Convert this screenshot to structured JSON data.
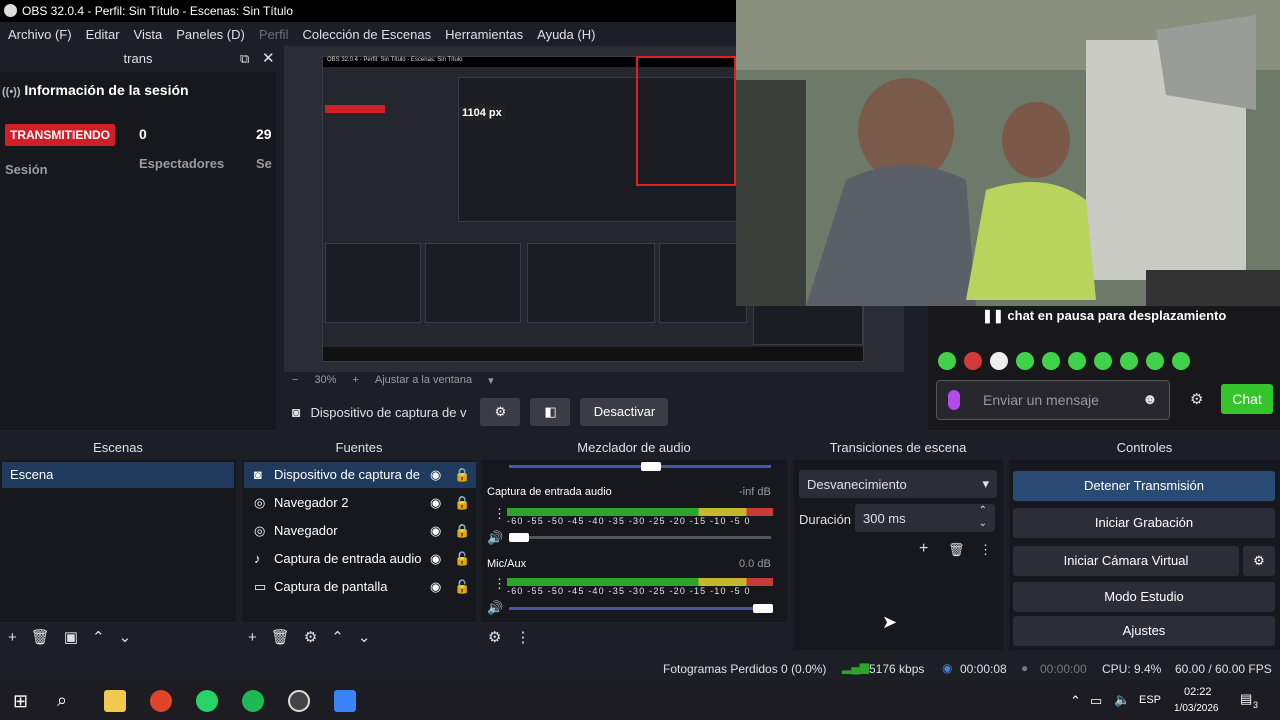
{
  "window": {
    "title": "OBS 32.0.4 - Perfil: Sin Título - Escenas: Sin Título"
  },
  "menu": {
    "items": [
      "Archivo (F)",
      "Editar",
      "Vista",
      "Paneles (D)",
      "Perfil",
      "Colección de Escenas",
      "Herramientas",
      "Ayuda (H)"
    ]
  },
  "dock": {
    "title": "trans",
    "session_heading": "Información de la sesión",
    "live_badge": "TRANSMITIENDO",
    "viewers_value": "0",
    "extra_value": "29",
    "session_label": "Sesión",
    "viewers_label": "Espectadores",
    "extra_label": "Se"
  },
  "preview": {
    "mini_title": "OBS 32.0.4 - Perfil: Sin Título - Escenas: Sin Título",
    "overlay_px": "1104 px",
    "zoom": "30%",
    "fit_label": "Ajustar a la ventana"
  },
  "source_toolbar": {
    "source_name": "Dispositivo de captura de v",
    "deactivate": "Desactivar"
  },
  "chat": {
    "paused": "chat en pausa para desplazamiento",
    "placeholder": "Enviar un mensaje",
    "button": "Chat"
  },
  "docks": {
    "scenes": "Escenas",
    "sources": "Fuentes",
    "mixer": "Mezclador de audio",
    "transitions": "Transiciones de escena",
    "controls": "Controles"
  },
  "scenes": [
    "Escena"
  ],
  "sources": [
    "Dispositivo de captura de v",
    "Navegador 2",
    "Navegador",
    "Captura de entrada audio",
    "Captura de pantalla"
  ],
  "mixer": {
    "ch1_name": "Captura de entrada audio",
    "ch1_db": "-inf dB",
    "ch2_name": "Mic/Aux",
    "ch2_db": "0.0 dB",
    "scale": "-60 -55 -50 -45 -40 -35 -30 -25 -20 -15 -10 -5 0"
  },
  "transitions": {
    "type": "Desvanecimiento",
    "duration_label": "Duración",
    "duration_value": "300 ms"
  },
  "controls": [
    "Detener Transmisión",
    "Iniciar Grabación",
    "Iniciar Cámara Virtual",
    "Modo Estudio",
    "Ajustes"
  ],
  "status": {
    "dropped": "Fotogramas Perdidos 0 (0.0%)",
    "bitrate": "5176 kbps",
    "stream_time": "00:00:08",
    "rec_time": "00:00:00",
    "cpu": "CPU: 9.4%",
    "fps": "60.00 / 60.00 FPS"
  },
  "taskbar": {
    "lang": "ESP",
    "time": "02:22",
    "date": "1/03/2026",
    "notif_count": "3"
  }
}
